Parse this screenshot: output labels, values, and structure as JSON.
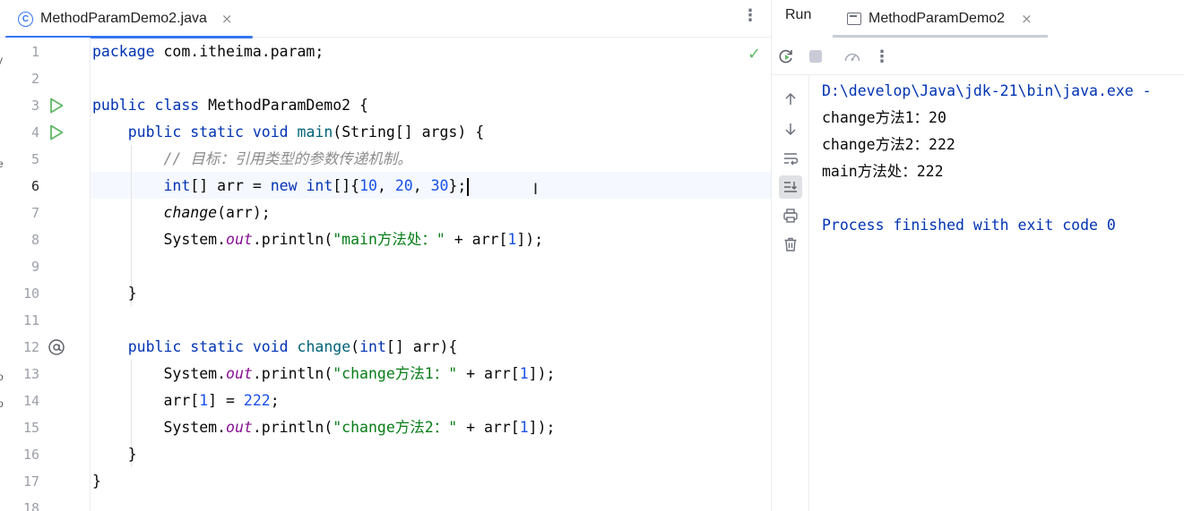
{
  "editor": {
    "tab_title": "MethodParamDemo2.java",
    "tab_icon": "class-icon",
    "tab_icon_glyph": "C",
    "close_glyph": "×",
    "menu_glyph": "⋮",
    "line_numbers": [
      "1",
      "2",
      "3",
      "4",
      "5",
      "6",
      "7",
      "8",
      "9",
      "10",
      "11",
      "12",
      "13",
      "14",
      "15",
      "16",
      "17",
      "18"
    ],
    "current_line": 6,
    "code": {
      "l1": {
        "kw": "package",
        "rest": " com.itheima.param;"
      },
      "l3": {
        "kw1": "public",
        "kw2": "class",
        "rest": " MethodParamDemo2 {"
      },
      "l4": {
        "kw1": "public",
        "kw2": "static",
        "kw3": "void",
        "method": "main",
        "rest": "(String[] args) {"
      },
      "l5": {
        "comment": "// 目标：引用类型的参数传递机制。"
      },
      "l6": {
        "t1": "int",
        "t2": "[] arr = ",
        "t3": "new",
        "t4": " ",
        "t5": "int",
        "t6": "[]{",
        "n1": "10",
        "s1": ", ",
        "n2": "20",
        "s2": ", ",
        "n3": "30",
        "t7": "};"
      },
      "l7": {
        "method": "change",
        "rest": "(arr);"
      },
      "l8": {
        "sys": "System.",
        "field": "out",
        "call": ".println(",
        "str": "\"main方法处：\"",
        "plus": " + arr[",
        "idx": "1",
        "end": "]);"
      },
      "l10": {
        "text": "}"
      },
      "l12": {
        "kw1": "public",
        "kw2": "static",
        "kw3": "void",
        "method": "change",
        "p1": "(",
        "kw4": "int",
        "p2": "[] arr){"
      },
      "l13": {
        "sys": "System.",
        "field": "out",
        "call": ".println(",
        "str": "\"change方法1：\"",
        "plus": " + arr[",
        "idx": "1",
        "end": "]);"
      },
      "l14": {
        "t1": "arr[",
        "idx": "1",
        "t2": "] = ",
        "num": "222",
        "t3": ";"
      },
      "l15": {
        "sys": "System.",
        "field": "out",
        "call": ".println(",
        "str": "\"change方法2：\"",
        "plus": " + arr[",
        "idx": "1",
        "end": "]);"
      },
      "l16": {
        "text": "}"
      },
      "l17": {
        "text": "}"
      }
    },
    "left_strip_glyphs": [
      "y",
      "e",
      "o",
      "o"
    ]
  },
  "run": {
    "label": "Run",
    "tab_title": "MethodParamDemo2",
    "close_glyph": "×",
    "toolbar_icons": [
      "rerun-icon",
      "stop-icon",
      "profiler-icon",
      "more-icon"
    ],
    "side_icons": [
      "up-arrow-icon",
      "down-arrow-icon",
      "soft-wrap-icon",
      "scroll-to-end-icon",
      "print-icon",
      "trash-icon"
    ],
    "console_lines": [
      "D:\\develop\\Java\\jdk-21\\bin\\java.exe -",
      "change方法1：20",
      "change方法2：222",
      "main方法处：222",
      "",
      "Process finished with exit code 0"
    ]
  },
  "colors": {
    "accent": "#3574f0",
    "keyword": "#0033b3",
    "string": "#067d17",
    "number": "#1750eb",
    "comment": "#8c8c8c",
    "static_field": "#871094",
    "method_decl": "#00627a",
    "run_green": "#5fb865"
  }
}
